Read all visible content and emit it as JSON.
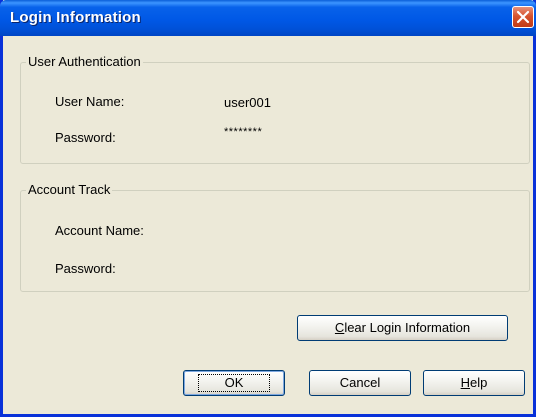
{
  "window": {
    "title": "Login Information"
  },
  "user_authentication": {
    "title": "User Authentication",
    "user_name_label": "User Name:",
    "user_name_value": "user001",
    "password_label": "Password:",
    "password_value": "********"
  },
  "account_track": {
    "title": "Account Track",
    "account_name_label": "Account Name:",
    "password_label": "Password:"
  },
  "buttons": {
    "clear_first": "C",
    "clear_rest": "lear Login Information",
    "ok": "OK",
    "cancel": "Cancel",
    "help_first": "H",
    "help_rest": "elp"
  },
  "icons": {
    "close": "close-icon"
  },
  "colors": {
    "titlebar": "#0058e6",
    "dialog_bg": "#ece9d8",
    "close_button": "#d6532f"
  }
}
